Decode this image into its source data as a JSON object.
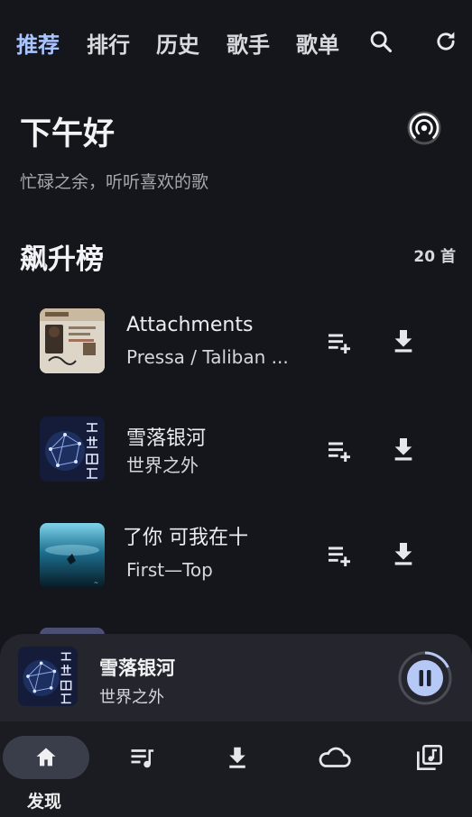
{
  "top_tabs": [
    {
      "label": "推荐",
      "active": true
    },
    {
      "label": "排行",
      "active": false
    },
    {
      "label": "历史",
      "active": false
    },
    {
      "label": "歌手",
      "active": false
    },
    {
      "label": "歌单",
      "active": false
    }
  ],
  "top_actions": {
    "search_icon": "search-icon",
    "refresh_icon": "refresh-icon"
  },
  "greeting": {
    "title": "下午好",
    "subtitle": "忙碌之余，听听喜欢的歌",
    "radar_icon": "radar-icon"
  },
  "section": {
    "title": "飙升榜",
    "count": "20 首"
  },
  "songs": [
    {
      "title": "Attachments",
      "artist": "Pressa / Taliban ..."
    },
    {
      "title": "雪落银河",
      "artist": "世界之外"
    },
    {
      "title": "了你  可我在十",
      "artist": "First—Top"
    }
  ],
  "player": {
    "title": "雪落银河",
    "artist": "世界之外",
    "progress": 0.18
  },
  "bottom_nav": {
    "active_label": "发现"
  },
  "colors": {
    "accent": "#a9c4ff",
    "background": "#15161b",
    "player": "#25262d"
  }
}
